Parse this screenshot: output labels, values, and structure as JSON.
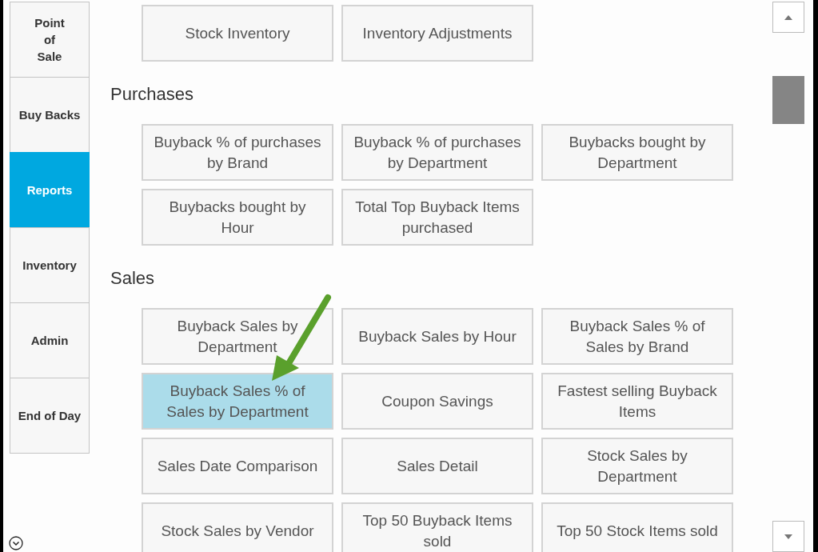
{
  "sidebar": {
    "items": [
      {
        "label": "Point\nof\nSale",
        "selected": false
      },
      {
        "label": "Buy Backs",
        "selected": false
      },
      {
        "label": "Reports",
        "selected": true
      },
      {
        "label": "Inventory",
        "selected": false
      },
      {
        "label": "Admin",
        "selected": false
      },
      {
        "label": "End of Day",
        "selected": false
      }
    ]
  },
  "sections": [
    {
      "buttons": [
        {
          "label": "Stock Inventory",
          "selected": false
        },
        {
          "label": "Inventory Adjustments",
          "selected": false
        }
      ]
    },
    {
      "heading": "Purchases",
      "buttons": [
        {
          "label": "Buyback % of purchases by Brand",
          "selected": false
        },
        {
          "label": "Buyback % of purchases by Department",
          "selected": false
        },
        {
          "label": "Buybacks bought by Department",
          "selected": false
        },
        {
          "label": "Buybacks bought by Hour",
          "selected": false
        },
        {
          "label": "Total Top Buyback Items purchased",
          "selected": false
        }
      ]
    },
    {
      "heading": "Sales",
      "buttons": [
        {
          "label": "Buyback Sales by Department",
          "selected": false
        },
        {
          "label": "Buyback Sales by Hour",
          "selected": false
        },
        {
          "label": "Buyback Sales % of Sales by Brand",
          "selected": false
        },
        {
          "label": "Buyback Sales % of Sales by Department",
          "selected": true
        },
        {
          "label": "Coupon Savings",
          "selected": false
        },
        {
          "label": "Fastest selling Buyback Items",
          "selected": false
        },
        {
          "label": "Sales Date Comparison",
          "selected": false
        },
        {
          "label": "Sales Detail",
          "selected": false
        },
        {
          "label": "Stock Sales by Department",
          "selected": false
        },
        {
          "label": "Stock Sales by Vendor",
          "selected": false
        },
        {
          "label": "Top 50 Buyback Items sold",
          "selected": false
        },
        {
          "label": "Top 50 Stock Items sold",
          "selected": false
        }
      ]
    }
  ]
}
